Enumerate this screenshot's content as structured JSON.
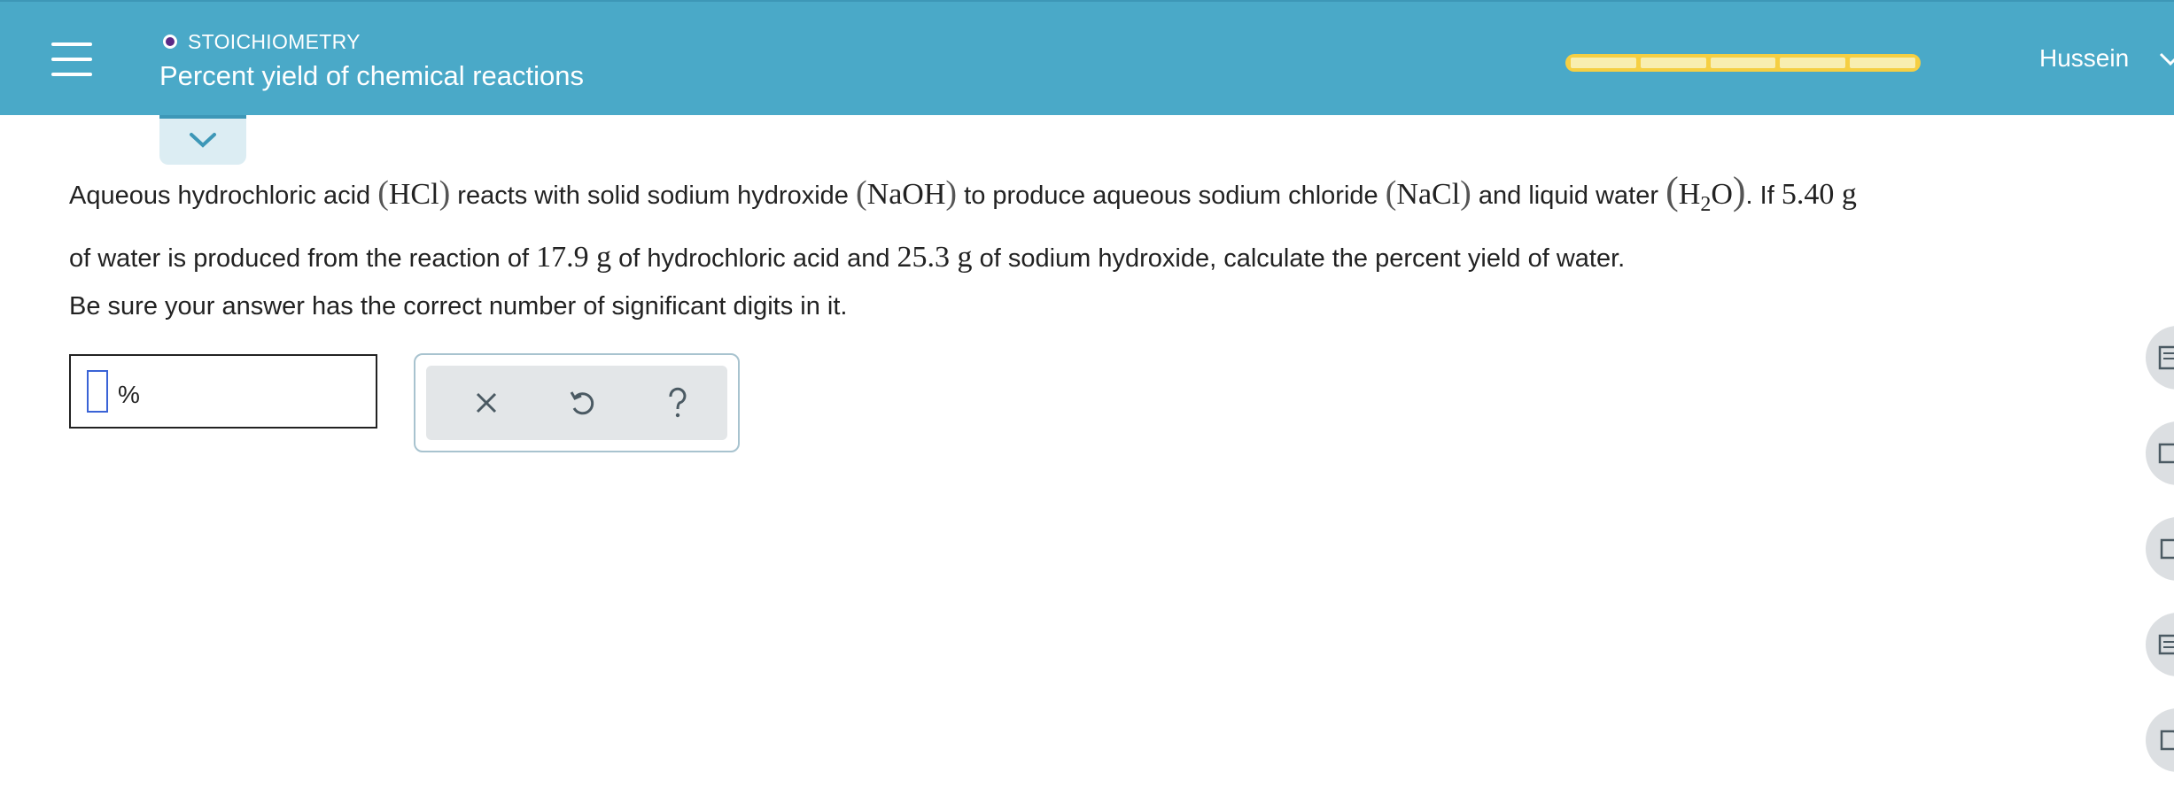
{
  "header": {
    "topic": "STOICHIOMETRY",
    "title": "Percent yield of chemical reactions",
    "user": "Hussein",
    "progress_segments": 5,
    "colors": {
      "bar": "#4aa9c8",
      "topic_dot": "#5b2a86",
      "progress": "#f5cf43"
    }
  },
  "question": {
    "line1": {
      "t1": "Aqueous hydrochloric acid",
      "hcl": "HCl",
      "t2": "reacts with solid sodium hydroxide",
      "naoh": "NaOH",
      "t3": "to produce aqueous sodium chloride",
      "nacl": "NaCl",
      "t4": "and liquid water",
      "h": "H",
      "sub2": "2",
      "o": "O",
      "t5": ". If",
      "mass_water": "5.40 g"
    },
    "line2": {
      "t1": "of water is produced from the reaction of",
      "mass_hcl": "17.9 g",
      "t2": "of hydrochloric acid and",
      "mass_naoh": "25.3 g",
      "t3": "of sodium hydroxide, calculate the percent yield of water."
    },
    "instruction": "Be sure your answer has the correct number of significant digits in it."
  },
  "answer": {
    "value": "",
    "unit": "%"
  },
  "tools": {
    "clear_icon": "x-icon",
    "undo_icon": "undo-icon",
    "help_icon": "question-icon"
  },
  "sidebar_icons": [
    "calculator-icon",
    "periodic-table-icon",
    "book-icon",
    "notes-icon",
    "data-icon"
  ]
}
